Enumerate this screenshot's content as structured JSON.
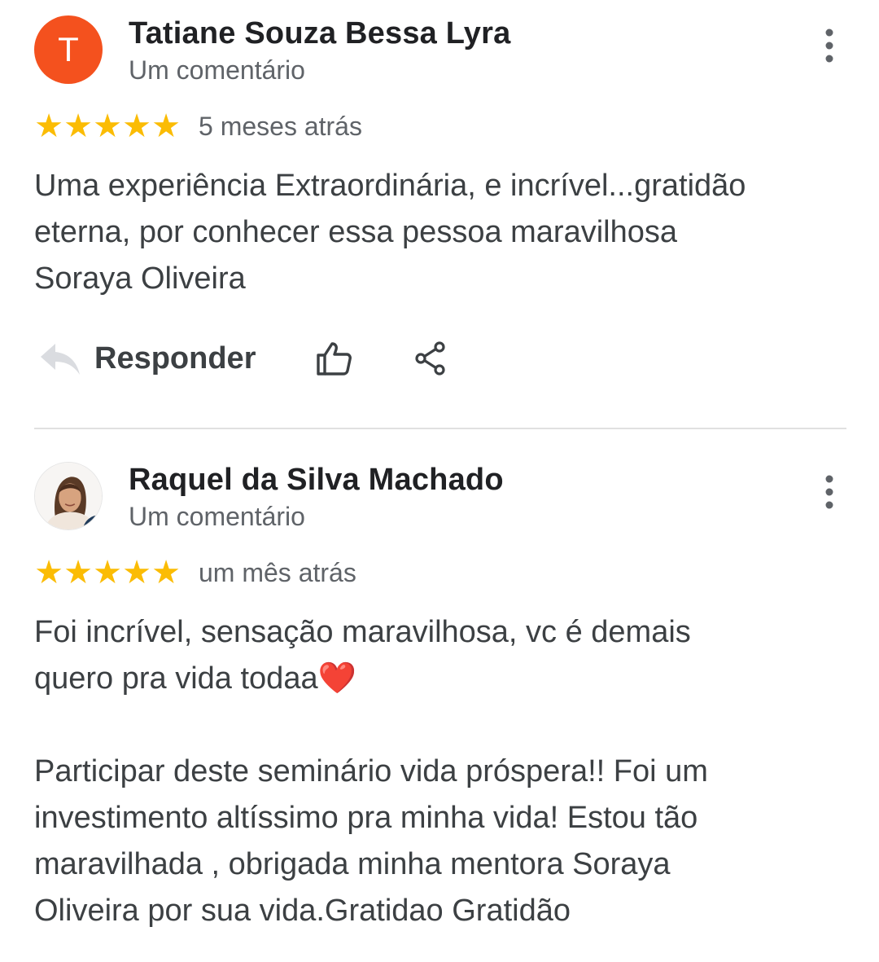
{
  "reviews": [
    {
      "avatar_letter": "T",
      "avatar_color": "#f4511e",
      "author": "Tatiane Souza Bessa Lyra",
      "subtitle": "Um comentário",
      "rating": 5,
      "time_ago": "5 meses atrás",
      "text": "Uma experiência Extraordinária, e incrível...gratidão\neterna, por conhecer essa pessoa maravilhosa\nSoraya Oliveira",
      "actions": {
        "reply_label": "Responder",
        "reply_icon": "reply-icon",
        "like_icon": "thumbs-up-icon",
        "share_icon": "share-icon"
      },
      "menu_icon": "more-vert-icon"
    },
    {
      "avatar_type": "photo",
      "author": "Raquel da Silva Machado",
      "subtitle": "Um comentário",
      "rating": 5,
      "time_ago": "um mês atrás",
      "text_line1": "Foi incrível, sensação maravilhosa,  vc é demais\nquero pra vida todaa",
      "text_emoji": "❤️",
      "text_line2": "Participar deste seminário vida próspera!! Foi um\ninvestimento altíssimo pra minha vida! Estou tão\nmaravilhada , obrigada minha mentora Soraya\nOliveira por sua vida.Gratidao Gratidão",
      "menu_icon": "more-vert-icon"
    }
  ],
  "colors": {
    "star": "#fbbc04",
    "text_primary": "#202124",
    "text_secondary": "#5f6368",
    "divider": "#e0e0e0"
  }
}
